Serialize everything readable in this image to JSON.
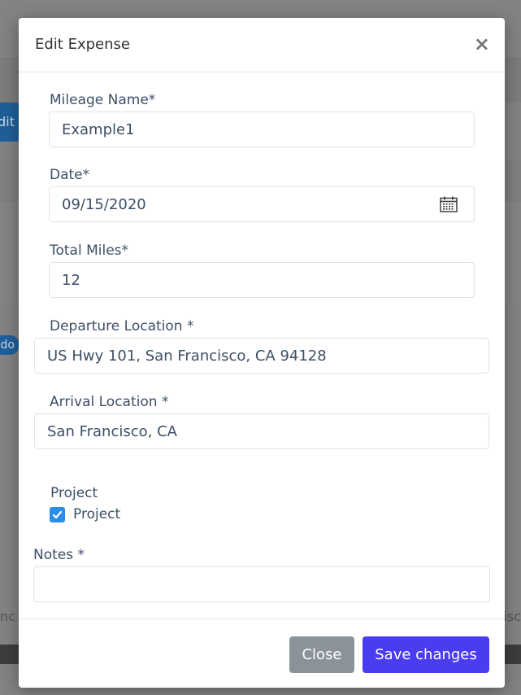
{
  "background": {
    "edit_fragment": "dit",
    "pill_fragment": "do",
    "text_left_fragment": "nc",
    "text_right_fragment": "isc"
  },
  "modal": {
    "title": "Edit Expense",
    "close_symbol": "×",
    "fields": {
      "mileage_name": {
        "label": "Mileage Name*",
        "value": "Example1"
      },
      "date": {
        "label": "Date*",
        "value": "09/15/2020",
        "icon": "calendar-icon"
      },
      "total_miles": {
        "label": "Total Miles*",
        "value": "12"
      },
      "departure": {
        "label": "Departure Location *",
        "value": "US Hwy 101, San Francisco, CA 94128"
      },
      "arrival": {
        "label": "Arrival Location *",
        "value": "San Francisco, CA"
      },
      "project": {
        "label": "Project",
        "checkbox_label": "Project",
        "checked": true
      },
      "notes": {
        "label": "Notes *",
        "value": ""
      }
    },
    "footer": {
      "close_label": "Close",
      "save_label": "Save changes"
    }
  },
  "colors": {
    "save_button": "#4a3df0",
    "close_button": "#8b929a",
    "checkbox": "#2c8de8",
    "label_text": "#3d4f66"
  }
}
